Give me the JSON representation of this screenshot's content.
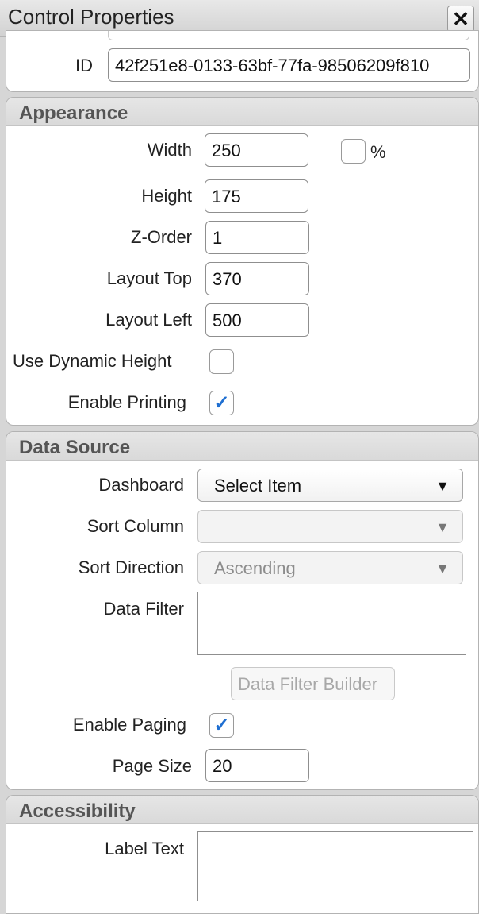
{
  "window": {
    "title": "Control Properties",
    "close_symbol": "✕"
  },
  "identity": {
    "id_label": "ID",
    "id_value": "42f251e8-0133-63bf-77fa-98506209f810"
  },
  "appearance": {
    "title": "Appearance",
    "width_label": "Width",
    "width_value": "250",
    "percent_label": "%",
    "percent_checked": false,
    "height_label": "Height",
    "height_value": "175",
    "zorder_label": "Z-Order",
    "zorder_value": "1",
    "layout_top_label": "Layout Top",
    "layout_top_value": "370",
    "layout_left_label": "Layout Left",
    "layout_left_value": "500",
    "dynamic_height_label": "Use Dynamic Height",
    "dynamic_height_checked": false,
    "enable_printing_label": "Enable Printing",
    "enable_printing_checked": true
  },
  "data_source": {
    "title": "Data Source",
    "dashboard_label": "Dashboard",
    "dashboard_value": "Select Item",
    "sort_column_label": "Sort Column",
    "sort_column_value": "",
    "sort_direction_label": "Sort Direction",
    "sort_direction_value": "Ascending",
    "data_filter_label": "Data Filter",
    "data_filter_value": "",
    "filter_builder_label": "Data Filter Builder",
    "enable_paging_label": "Enable Paging",
    "enable_paging_checked": true,
    "page_size_label": "Page Size",
    "page_size_value": "20"
  },
  "accessibility": {
    "title": "Accessibility",
    "label_text_label": "Label Text",
    "label_text_value": ""
  },
  "icons": {
    "check": "✓",
    "dropdown_arrow": "▼"
  }
}
